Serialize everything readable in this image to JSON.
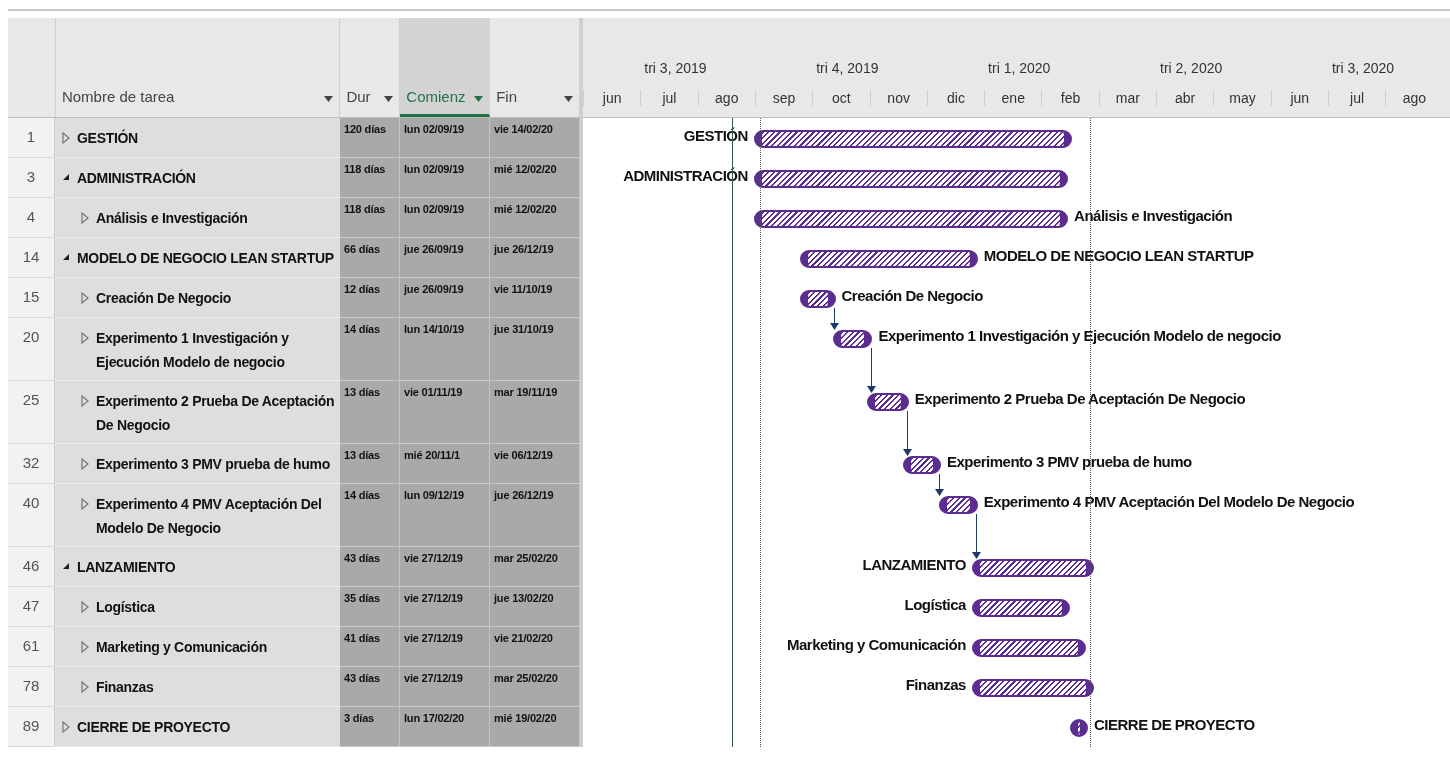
{
  "columns": [
    {
      "label": "Nombre de tarea",
      "selected": false
    },
    {
      "label": "Dur",
      "selected": false
    },
    {
      "label": "Comienz",
      "selected": true
    },
    {
      "label": "Fin",
      "selected": false
    }
  ],
  "timeline": {
    "quarters": [
      "tri 3, 2019",
      "tri 4, 2019",
      "tri 1, 2020",
      "tri 2, 2020",
      "tri 3, 2020"
    ],
    "months": [
      "jun",
      "jul",
      "ago",
      "sep",
      "oct",
      "nov",
      "dic",
      "ene",
      "feb",
      "mar",
      "abr",
      "may",
      "jun",
      "jul",
      "ago"
    ]
  },
  "tasks": [
    {
      "id": "1",
      "name": "GESTIÓN",
      "duration": "120 días",
      "start": "lun 02/09/19",
      "end": "vie 14/02/20",
      "expanded": false,
      "bar_label": "GESTIÓN",
      "label_left": true,
      "linked": false
    },
    {
      "id": "3",
      "name": "ADMINISTRACIÓN",
      "duration": "118 días",
      "start": "lun 02/09/19",
      "end": "mié 12/02/20",
      "expanded": true,
      "bar_label": "ADMINISTRACIÓN",
      "label_left": true,
      "linked": false,
      "children": [
        {
          "id": "4",
          "name": "Análisis e Investigación",
          "duration": "118 días",
          "start": "lun 02/09/19",
          "end": "mié 12/02/20",
          "expanded": false,
          "bar_label": "Análisis e Investigación",
          "label_left": false,
          "linked": false
        }
      ]
    },
    {
      "id": "14",
      "name": "MODELO DE NEGOCIO LEAN STARTUP",
      "duration": "66 días",
      "start": "jue 26/09/19",
      "end": "jue 26/12/19",
      "expanded": true,
      "bar_label": "MODELO DE NEGOCIO LEAN STARTUP",
      "label_left": false,
      "linked": false,
      "children": [
        {
          "id": "15",
          "name": "Creación De Negocio",
          "duration": "12 días",
          "start": "jue 26/09/19",
          "end": "vie 11/10/19",
          "expanded": false,
          "bar_label": "Creación De Negocio",
          "label_left": false,
          "linked": false
        },
        {
          "id": "20",
          "name": "Experimento 1 Investigación y Ejecución Modelo de negocio",
          "duration": "14 días",
          "start": "lun 14/10/19",
          "end": "jue 31/10/19",
          "expanded": false,
          "bar_label": "Experimento 1 Investigación y Ejecución Modelo de negocio",
          "label_left": false,
          "linked": true
        },
        {
          "id": "25",
          "name": "Experimento 2 Prueba De Aceptación De Negocio",
          "duration": "13 días",
          "start": "vie 01/11/19",
          "end": "mar 19/11/19",
          "expanded": false,
          "bar_label": "Experimento 2 Prueba De Aceptación De Negocio",
          "label_left": false,
          "linked": true
        },
        {
          "id": "32",
          "name": "Experimento 3 PMV prueba de humo",
          "duration": "13 días",
          "start": "mié 20/11/1",
          "end": "vie 06/12/19",
          "expanded": false,
          "bar_label": "Experimento 3 PMV prueba de humo",
          "label_left": false,
          "linked": true
        },
        {
          "id": "40",
          "name": "Experimento 4 PMV Aceptación Del Modelo De Negocio",
          "duration": "14 días",
          "start": "lun 09/12/19",
          "end": "jue 26/12/19",
          "expanded": false,
          "bar_label": "Experimento 4 PMV Aceptación Del Modelo De Negocio",
          "label_left": false,
          "linked": true
        }
      ]
    },
    {
      "id": "46",
      "name": "LANZAMIENTO",
      "duration": "43 días",
      "start": "vie 27/12/19",
      "end": "mar 25/02/20",
      "expanded": true,
      "bar_label": "LANZAMIENTO",
      "label_left": true,
      "linked": true,
      "children": [
        {
          "id": "47",
          "name": "Logística",
          "duration": "35 días",
          "start": "vie 27/12/19",
          "end": "jue 13/02/20",
          "expanded": false,
          "bar_label": "Logística",
          "label_left": true,
          "linked": false
        },
        {
          "id": "61",
          "name": "Marketing y Comunicación",
          "duration": "41 días",
          "start": "vie 27/12/19",
          "end": "vie 21/02/20",
          "expanded": false,
          "bar_label": "Marketing y Comunicación",
          "label_left": true,
          "linked": false
        },
        {
          "id": "78",
          "name": "Finanzas",
          "duration": "43 días",
          "start": "vie 27/12/19",
          "end": "mar 25/02/20",
          "expanded": false,
          "bar_label": "Finanzas",
          "label_left": true,
          "linked": false
        }
      ]
    },
    {
      "id": "89",
      "name": "CIERRE DE PROYECTO",
      "duration": "3 días",
      "start": "lun 17/02/20",
      "end": "mié 19/02/20",
      "expanded": false,
      "bar_label": "CIERRE DE PROYECTO",
      "label_left": false,
      "linked": false
    }
  ]
}
